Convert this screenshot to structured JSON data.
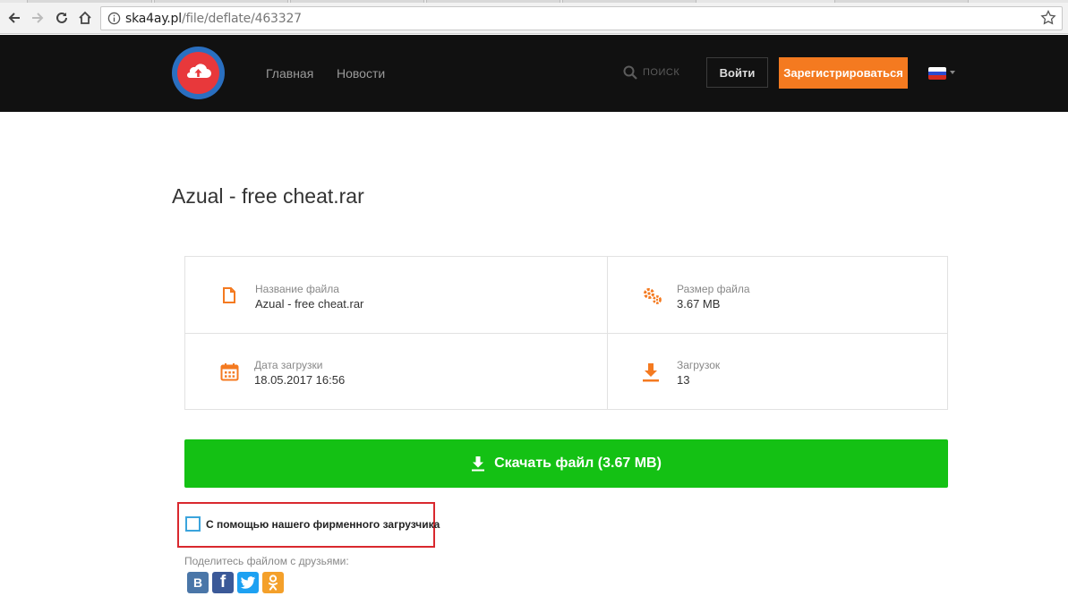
{
  "browser": {
    "url_host": "ska4ay.pl",
    "url_path": "/file/deflate/463327"
  },
  "header": {
    "nav": [
      {
        "label": "Главная"
      },
      {
        "label": "Новости"
      }
    ],
    "search_placeholder": "ПОИСК",
    "login_label": "Войти",
    "register_label": "Зарегистрироваться",
    "language": "ru",
    "colors": {
      "background": "#111111",
      "accent": "#f47a20",
      "logo_ring": "#2a6fc0",
      "logo_core": "#e8383b"
    }
  },
  "file": {
    "title": "Azual - free cheat.rar",
    "name_label": "Название файла",
    "name_value": "Azual - free cheat.rar",
    "size_label": "Размер файла",
    "size_value": "3.67 MB",
    "date_label": "Дата загрузки",
    "date_value": "18.05.2017 16:56",
    "downloads_label": "Загрузок",
    "downloads_value": "13"
  },
  "download": {
    "button_label": "Скачать файл (3.67 MB)",
    "color": "#14c114"
  },
  "loader_option": {
    "label": "С помощью нашего фирменного загрузчика",
    "checked": false
  },
  "share": {
    "label": "Поделитесь файлом с друзьями:",
    "networks": [
      {
        "name": "vk",
        "glyph": "В",
        "color": "#4a76a8"
      },
      {
        "name": "facebook",
        "glyph": "f",
        "color": "#3b5998"
      },
      {
        "name": "twitter",
        "glyph": "t",
        "color": "#1da1f2"
      },
      {
        "name": "odnoklassniki",
        "glyph": "ok",
        "color": "#f4a02a"
      }
    ]
  }
}
